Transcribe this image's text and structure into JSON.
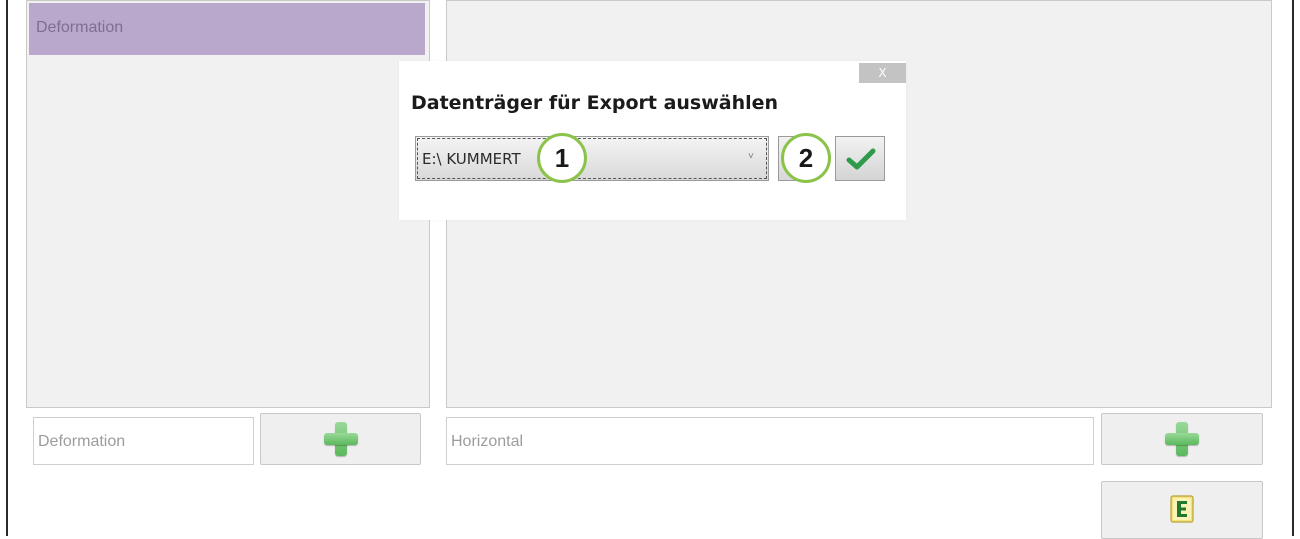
{
  "left_panel": {
    "selected_item": "Deformation",
    "input_placeholder": "Deformation"
  },
  "right_panel": {
    "input_placeholder": "Horizontal"
  },
  "dialog": {
    "close_label": "X",
    "title": "Datenträger für Export auswählen",
    "drive_value": "E:\\ KUMMERT",
    "chevron": "˅"
  },
  "callouts": {
    "one": "1",
    "two": "2"
  },
  "icons": {
    "add": "plus-icon",
    "export": "export-e-icon",
    "confirm": "check-icon"
  },
  "colors": {
    "selected_item_bg": "#b9a8cb",
    "accent_green": "#5cb85c",
    "callout_ring": "#8bc34a"
  }
}
